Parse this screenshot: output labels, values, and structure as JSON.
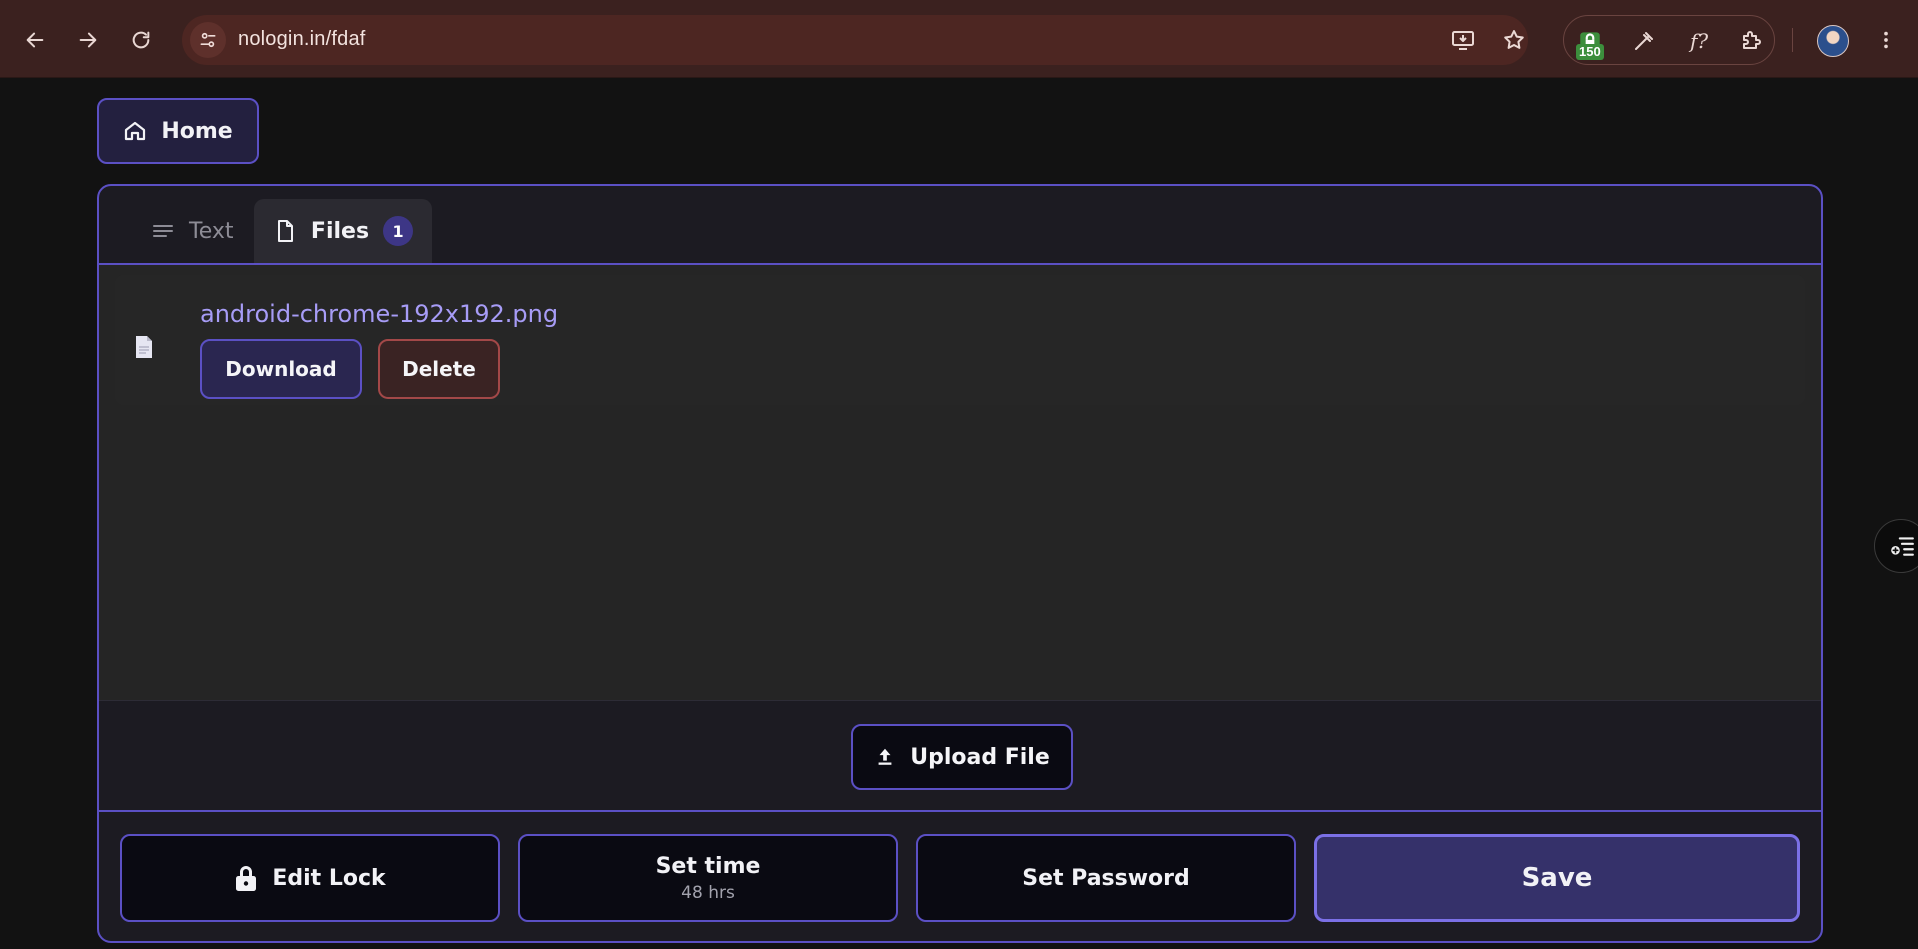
{
  "browser": {
    "url": "nologin.in/fdaf",
    "extension_badge": "150"
  },
  "page": {
    "home_label": "Home",
    "tabs": [
      {
        "label": "Text"
      },
      {
        "label": "Files",
        "count": "1"
      }
    ],
    "files": [
      {
        "name": "android-chrome-192x192.png",
        "download_label": "Download",
        "delete_label": "Delete"
      }
    ],
    "upload_label": "Upload File",
    "actions": {
      "edit_lock": "Edit Lock",
      "set_time": "Set time",
      "set_time_value": "48 hrs",
      "set_password": "Set Password",
      "save": "Save"
    }
  },
  "colors": {
    "accent_border": "#5b50c4",
    "file_link": "#a79cf6",
    "danger_border": "#a34848",
    "chrome_bg": "#3b211f"
  }
}
